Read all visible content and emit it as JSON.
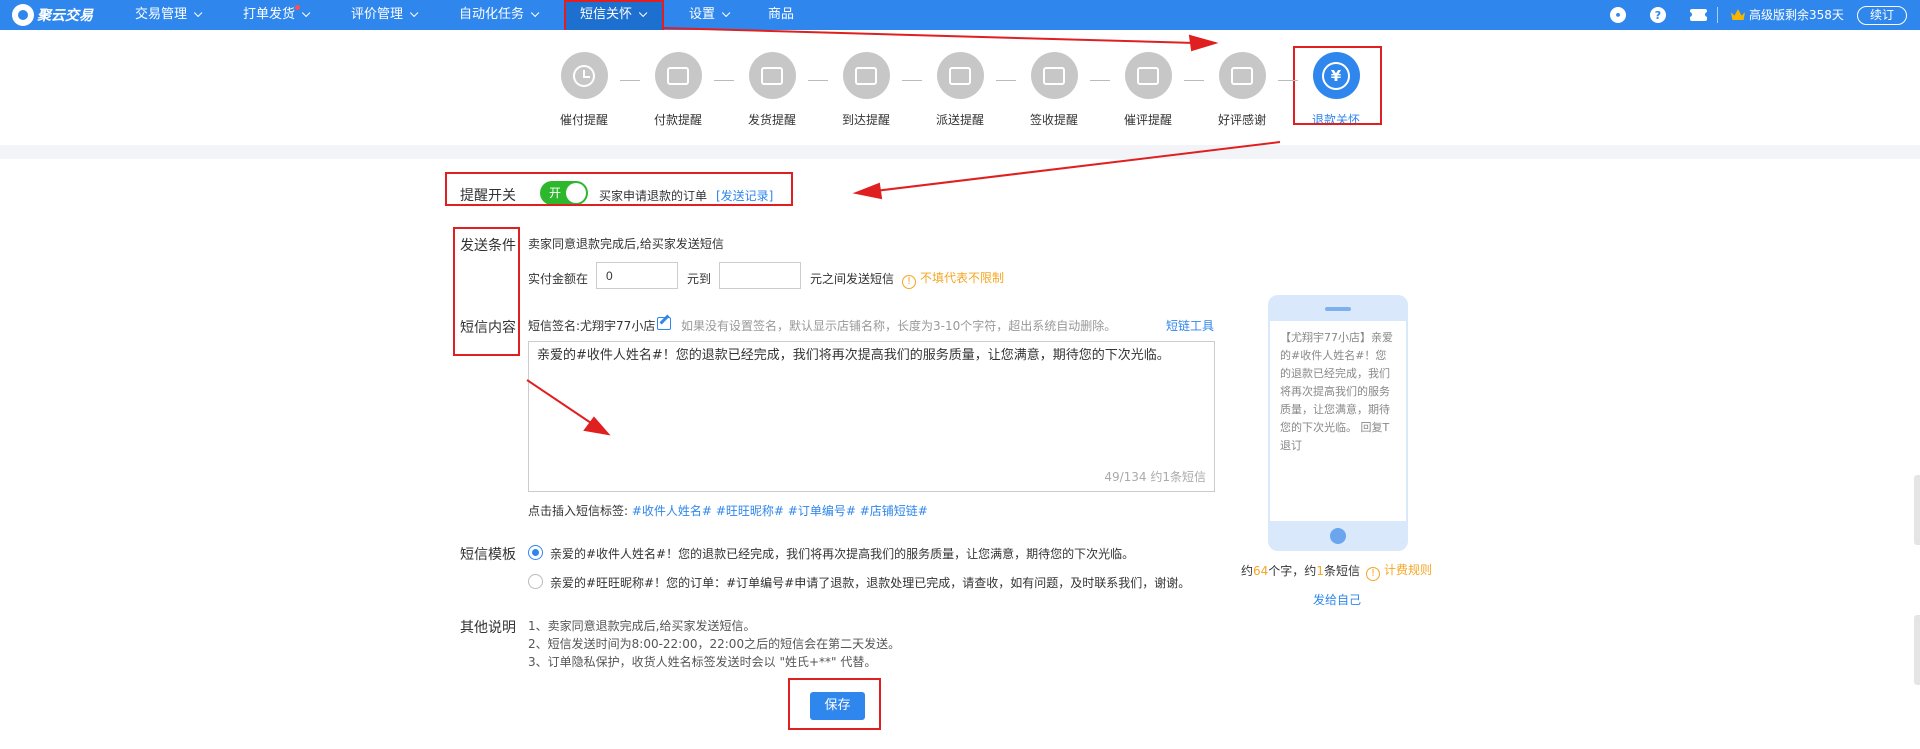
{
  "brand": {
    "logo_text": "聚云交易"
  },
  "nav": {
    "items": [
      {
        "label": "交易管理"
      },
      {
        "label": "打单发货"
      },
      {
        "label": "评价管理"
      },
      {
        "label": "自动化任务"
      },
      {
        "label": "短信关怀"
      },
      {
        "label": "设置"
      },
      {
        "label": "商品"
      }
    ],
    "vip_text": "高级版剩余358天",
    "renew_label": "续订",
    "help_glyph": "?"
  },
  "steps": [
    {
      "label": "催付提醒"
    },
    {
      "label": "付款提醒"
    },
    {
      "label": "发货提醒"
    },
    {
      "label": "到达提醒"
    },
    {
      "label": "派送提醒"
    },
    {
      "label": "签收提醒"
    },
    {
      "label": "催评提醒"
    },
    {
      "label": "好评感谢"
    },
    {
      "label": "退款关怀",
      "glyph": "¥"
    }
  ],
  "reminder": {
    "label": "提醒开关",
    "toggle_text": "开",
    "toggle_on": true,
    "desc": "买家申请退款的订单",
    "record_link": "[发送记录]"
  },
  "condition": {
    "label": "发送条件",
    "desc": "卖家同意退款完成后,给买家发送短信",
    "amount_prefix": "实付金额在",
    "amount_from": "0",
    "amount_to": "",
    "unit_to": "元到",
    "amount_suffix": "元之间发送短信",
    "warn_glyph": "!",
    "unlimited_hint": "不填代表不限制"
  },
  "sms": {
    "label": "短信内容",
    "signature": "短信签名:尤翔宇77小店",
    "signature_hint": "如果没有设置签名，默认显示店铺名称，长度为3-10个字符，超出系统自动删除。",
    "link_tool": "短链工具",
    "content": "亲爱的#收件人姓名#！您的退款已经完成，我们将再次提高我们的服务质量，让您满意，期待您的下次光临。",
    "counter": "49/134  约1条短信",
    "tags_prefix": "点击插入短信标签:",
    "tags": [
      "#收件人姓名#",
      "#旺旺昵称#",
      "#订单编号#",
      "#店铺短链#"
    ]
  },
  "template": {
    "label": "短信模板",
    "options": [
      {
        "text": "亲爱的#收件人姓名#！您的退款已经完成，我们将再次提高我们的服务质量，让您满意，期待您的下次光临。",
        "selected": true
      },
      {
        "text": "亲爱的#旺旺昵称#！您的订单：#订单编号#申请了退款，退款处理已完成，请查收，如有问题，及时联系我们，谢谢。",
        "selected": false
      }
    ]
  },
  "notes": {
    "label": "其他说明",
    "items": [
      "1、卖家同意退款完成后,给买家发送短信。",
      "2、短信发送时间为8:00-22:00，22:00之后的短信会在第二天发送。",
      "3、订单隐私保护，收货人姓名标签发送时会以 \"姓氏+**\" 代替。"
    ]
  },
  "save_label": "保存",
  "preview": {
    "text": "【尤翔宇77小店】亲爱的#收件人姓名#！您的退款已经完成，我们将再次提高我们的服务质量，让您满意，期待您的下次光临。 回复T退订",
    "count_prefix": "约",
    "chars": "64",
    "count_mid": "个字，约",
    "messages": "1",
    "count_suffix": "条短信",
    "warn_glyph": "!",
    "billing_rule": "计费规则",
    "send_self": "发给自己"
  },
  "colors": {
    "primary": "#2f86ec",
    "highlight": "#e02020",
    "toggle_on": "#2cb72c",
    "warn": "#f5a623"
  }
}
